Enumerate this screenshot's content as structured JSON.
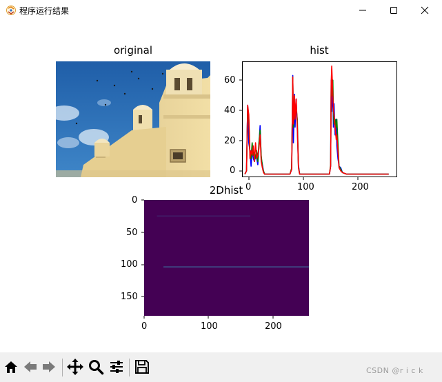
{
  "window": {
    "title": "程序运行结果",
    "icon": "python-app-icon",
    "controls": [
      "minimize-icon",
      "maximize-icon",
      "close-icon"
    ]
  },
  "figure": {
    "subplots": [
      {
        "title": "original",
        "kind": "image"
      },
      {
        "title": "hist",
        "kind": "line",
        "x_ticks": [
          "0",
          "100",
          "200"
        ],
        "y_ticks": [
          "0",
          "20",
          "40",
          "60"
        ]
      },
      {
        "title": "2Dhist",
        "kind": "heatmap",
        "x_ticks": [
          "0",
          "100",
          "200"
        ],
        "y_ticks": [
          "0",
          "50",
          "100",
          "150"
        ]
      }
    ]
  },
  "chart_data": [
    {
      "type": "line",
      "title": "hist",
      "xlim": [
        -5,
        270
      ],
      "ylim": [
        -2,
        72
      ],
      "grid": false,
      "series": [
        {
          "color": "#0000ff",
          "x": [
            0,
            3,
            5,
            7,
            9,
            11,
            13,
            15,
            17,
            19,
            21,
            23,
            25,
            27,
            29,
            31,
            33,
            35,
            40,
            80,
            83,
            85,
            86,
            88,
            89,
            91,
            93,
            95,
            97,
            100,
            150,
            152,
            153,
            154,
            156,
            157,
            158,
            160,
            162,
            163,
            165,
            167,
            170,
            173,
            180,
            255
          ],
          "y": [
            0,
            2,
            44,
            20,
            15,
            5,
            15,
            10,
            8,
            12,
            10,
            6,
            18,
            31,
            10,
            6,
            2,
            0,
            0,
            0,
            3,
            63,
            20,
            51,
            30,
            48,
            28,
            6,
            0,
            0,
            0,
            5,
            60,
            40,
            55,
            30,
            45,
            25,
            35,
            18,
            10,
            5,
            4,
            1,
            0,
            0
          ]
        },
        {
          "color": "#008000",
          "x": [
            0,
            3,
            5,
            7,
            9,
            11,
            13,
            15,
            17,
            19,
            21,
            23,
            25,
            27,
            29,
            31,
            33,
            35,
            40,
            80,
            83,
            85,
            86,
            88,
            89,
            91,
            93,
            95,
            97,
            100,
            150,
            152,
            153,
            154,
            156,
            157,
            158,
            160,
            162,
            163,
            165,
            167,
            170,
            173,
            180,
            255
          ],
          "y": [
            0,
            2,
            43,
            35,
            12,
            10,
            20,
            12,
            14,
            10,
            15,
            8,
            20,
            28,
            12,
            5,
            2,
            0,
            0,
            0,
            4,
            62,
            30,
            45,
            38,
            42,
            35,
            5,
            0,
            0,
            0,
            6,
            55,
            50,
            60,
            40,
            32,
            35,
            30,
            35,
            20,
            5,
            3,
            1,
            0,
            0
          ]
        },
        {
          "color": "#ff0000",
          "x": [
            0,
            3,
            5,
            7,
            9,
            11,
            13,
            15,
            17,
            19,
            21,
            23,
            25,
            27,
            29,
            31,
            33,
            35,
            40,
            80,
            83,
            85,
            86,
            88,
            89,
            91,
            93,
            95,
            97,
            100,
            150,
            152,
            153,
            154,
            156,
            157,
            158,
            160,
            162,
            163,
            165,
            167,
            170,
            173,
            180,
            255
          ],
          "y": [
            0,
            2,
            44,
            38,
            10,
            15,
            12,
            18,
            8,
            20,
            10,
            12,
            16,
            25,
            8,
            4,
            1,
            0,
            0,
            0,
            3,
            62,
            32,
            50,
            35,
            48,
            30,
            4,
            0,
            0,
            0,
            5,
            58,
            69,
            50,
            42,
            38,
            30,
            22,
            25,
            15,
            4,
            2,
            1,
            0,
            0
          ]
        }
      ]
    },
    {
      "type": "heatmap",
      "title": "2Dhist",
      "xlim": [
        0,
        256
      ],
      "ylim": [
        180,
        0
      ],
      "colormap": "viridis",
      "background": "#440154",
      "features": [
        {
          "y": 25,
          "x_start": 20,
          "x_end": 165,
          "intensity": 0.18
        },
        {
          "y": 104,
          "x_start": 30,
          "x_end": 256,
          "intensity": 0.45
        }
      ]
    }
  ],
  "toolbar": {
    "buttons": [
      "home-icon",
      "back-icon",
      "forward-icon",
      "pan-icon",
      "zoom-icon",
      "configure-subplots-icon",
      "save-icon"
    ]
  },
  "watermark": "CSDN @r i c k"
}
